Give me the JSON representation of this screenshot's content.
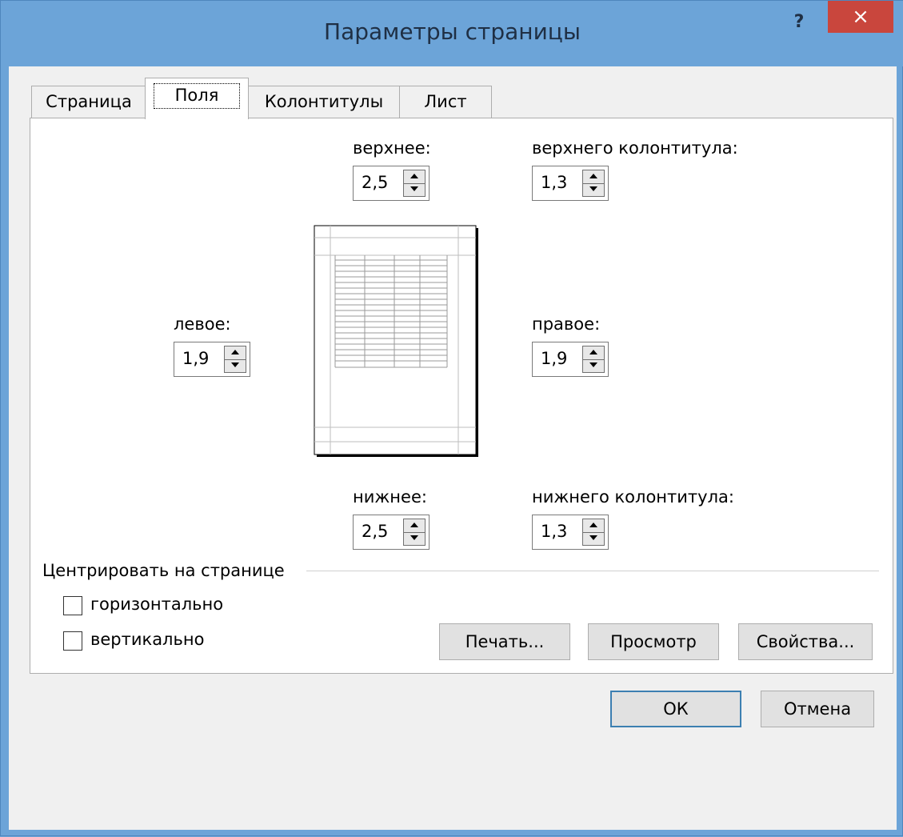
{
  "window": {
    "title": "Параметры страницы",
    "help": "?",
    "close": "×"
  },
  "tabs": [
    {
      "label": "Страница"
    },
    {
      "label": "Поля"
    },
    {
      "label": "Колонтитулы"
    },
    {
      "label": "Лист"
    }
  ],
  "margins": {
    "top": {
      "label": "верхнее:",
      "value": "2,5"
    },
    "header": {
      "label": "верхнего колонтитула:",
      "value": "1,3"
    },
    "left": {
      "label": "левое:",
      "value": "1,9"
    },
    "right": {
      "label": "правое:",
      "value": "1,9"
    },
    "bottom": {
      "label": "нижнее:",
      "value": "2,5"
    },
    "footer": {
      "label": "нижнего колонтитула:",
      "value": "1,3"
    }
  },
  "center": {
    "title": "Центрировать на странице",
    "horizontal": {
      "label": "горизонтально",
      "checked": false
    },
    "vertical": {
      "label": "вертикально",
      "checked": false
    }
  },
  "buttons": {
    "print": "Печать...",
    "preview": "Просмотр",
    "properties": "Свойства...",
    "ok": "ОК",
    "cancel": "Отмена"
  },
  "colors": {
    "titlebar": "#6ca4d8",
    "close": "#c9463d",
    "accent": "#3c7fb1"
  },
  "icons": {
    "help": "question-mark-icon",
    "close": "close-icon",
    "spin-up": "triangle-up-icon",
    "spin-down": "triangle-down-icon",
    "page-preview": "page-preview-icon"
  }
}
